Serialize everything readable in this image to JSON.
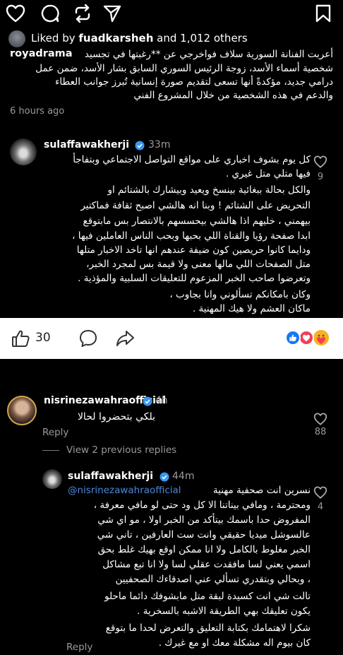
{
  "post": {
    "liked_by_prefix": "Liked by ",
    "liked_by_user": "fuadkarsheh",
    "liked_by_suffix": " and 1,012 others",
    "author": "royadrama",
    "caption_lines": [
      "أعربت الفنانة السورية سلاف فواخرجي عن **رغبتها في تجسيد",
      "شخصية أسماء الأسد، زوجة الرئيس السوري السابق بشار الأسد، ضمن عمل",
      "درامي جديد، مؤكدةً أنها تسعى لتقديم صورة إنسانية تُبرز جوانب العطاء",
      "والدعم في هذه الشخصية من خلال المشروع الفني"
    ],
    "time": "6 hours ago"
  },
  "comment1": {
    "user": "sulaffawakherji",
    "time": "33m",
    "like_count": "9",
    "lines": [
      "كل يوم بشوف اخباري على مواقع التواصل الاجتماعي وبتفاجأ",
      "فيها متلي متل غيري .",
      "والكل بحالة ببغائية بينسخ ويعيد وبيشارك بالشتائم او",
      "التحريض على الشتائم ! وبنا انه هالشي اصبح ثقافة فماكتير",
      "بيهمني ، خليهم اذا هالشي بيحسسهم بالانتصار بس مابتوقع",
      "ابدا صفحة رؤيا والقناة اللي بحبها وبحب الناس العاملين فيها ،",
      "ودايما كانوا حريصين كون ضيفة عندهم انها تاخد الاخبار متلها",
      "متل الصفحات اللي مالها معنى ولا قيمة بس لمجرد الخبر،",
      "وتعرضوا صاحب الخبر المزعوم للتعليقات السلبية والمؤذية .",
      "وكان بامكانكم تسألوني وانا بجاوب ،",
      "ماكان العشم ولا هيك المهنية ."
    ]
  },
  "fb_bar": {
    "like_count": "30"
  },
  "comment2": {
    "user": "nisrinezawahraofficial",
    "time": "4h",
    "text": "بلكي بتحضروا لحالا",
    "reply": "Reply",
    "like_count": "88",
    "view_replies": "View 2 previous replies"
  },
  "reply1": {
    "user": "sulaffawakherji",
    "time": "44m",
    "mention": "@nisrinezawahraofficial",
    "first_line_rest": " نسرين انت صحفية مهنية",
    "lines": [
      "ومحترمة ، ومافي بيناتنا الا كل ود حتى لو مافي معرفة ،",
      "المفروض حدا باسمك بيتأكد من الخبر اولا ، مو اي شي",
      "عالسوشل ميديا حقيقي وانت ست العارفين ، تاني شي",
      "الخبر مغلوط بالكامل ولا انا ممكن اوقع بهيك غلط بحق",
      "اسمي يعني لسا مافقدت عقلي لسا ولا انا تبع مشاكل",
      "، وبحالي وبتقدري تسألي عني اصدقاءك الصحفيين",
      "تالت شي انت كسيدة لبقة متل مابشوفك دائما ماحلو",
      "يكون تعليقك بهي الطريقة الاشبه بالسخرية .",
      "شكرا لاهتمامك بكتابة التعليق والتعرض لحدا ما بتوقع",
      "كان بيوم اله مشكلة معك او مع غيرك ."
    ],
    "like_count": "4",
    "reply": "Reply"
  },
  "colors": {
    "verified": "#3897f0",
    "link": "#4a87d9",
    "grey": "#9a9a9a"
  }
}
